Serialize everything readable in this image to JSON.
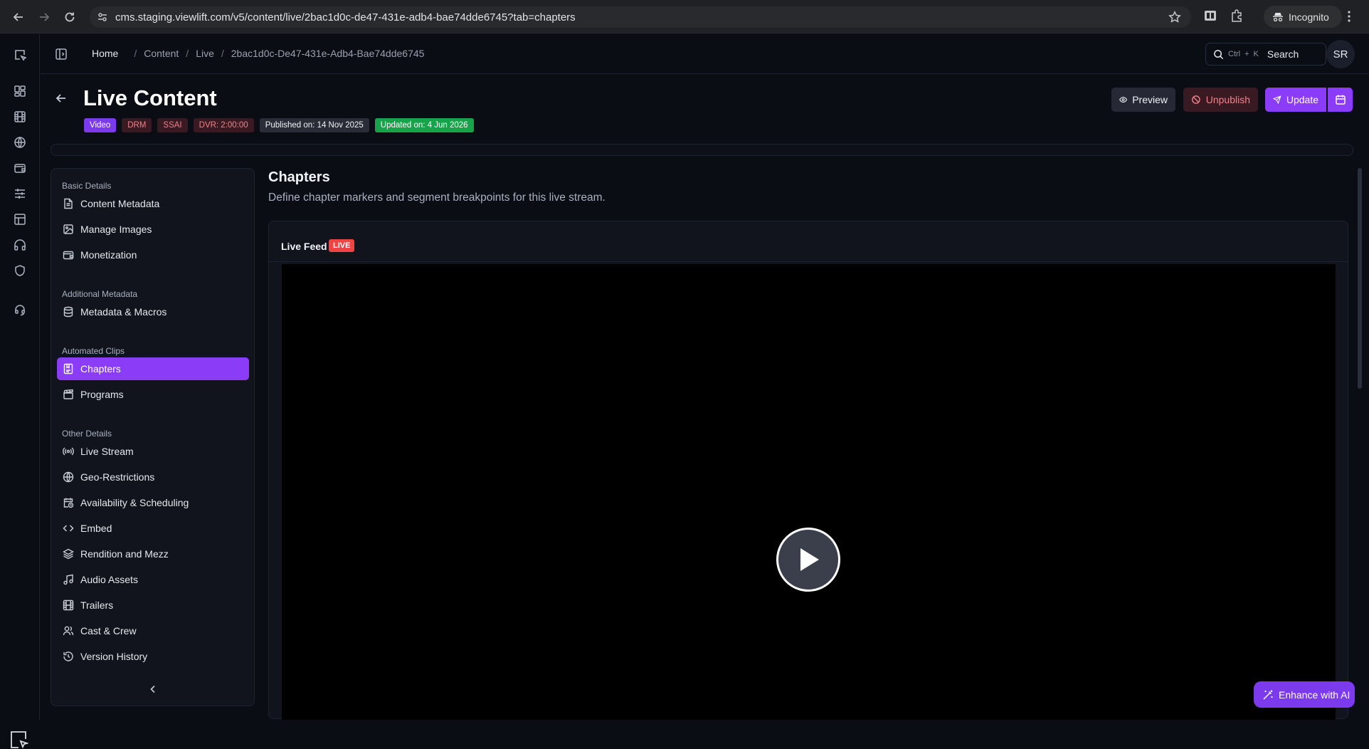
{
  "browser": {
    "url": "cms.staging.viewlift.com/v5/content/live/2bac1d0c-de47-431e-adb4-bae74dde6745?tab=chapters",
    "mode_label": "Incognito"
  },
  "header": {
    "breadcrumbs": {
      "home": "Home",
      "items": [
        "Content",
        "Live",
        "2bac1d0c-De47-431e-Adb4-Bae74dde6745"
      ]
    },
    "search": {
      "shortcut_mod": "Ctrl",
      "shortcut_plus": "+",
      "shortcut_key": "K",
      "label": "Search"
    },
    "avatar_initials": "SR"
  },
  "page": {
    "title": "Live Content",
    "badges": {
      "type": "Video",
      "drm": "DRM",
      "ssai": "SSAI",
      "dvr": "DVR: 2:00:00",
      "published": "Published on: 14 Nov 2025",
      "updated": "Updated on: 4 Jun 2026"
    },
    "actions": {
      "preview": "Preview",
      "unpublish": "Unpublish",
      "update": "Update"
    }
  },
  "sidenav": {
    "sections": [
      {
        "title": "Basic Details",
        "items": [
          "Content Metadata",
          "Manage Images",
          "Monetization"
        ]
      },
      {
        "title": "Additional Metadata",
        "items": [
          "Metadata & Macros"
        ]
      },
      {
        "title": "Automated Clips",
        "items": [
          "Chapters",
          "Programs"
        ]
      },
      {
        "title": "Other Details",
        "items": [
          "Live Stream",
          "Geo-Restrictions",
          "Availability & Scheduling",
          "Embed",
          "Rendition and Mezz",
          "Audio Assets",
          "Trailers",
          "Cast & Crew",
          "Version History"
        ]
      }
    ],
    "active_item": "Chapters"
  },
  "main": {
    "heading": "Chapters",
    "description": "Define chapter markers and segment breakpoints for this live stream.",
    "feed": {
      "label": "Live Feed",
      "status": "LIVE"
    }
  },
  "floating": {
    "enhance_label": "Enhance with AI"
  },
  "colors": {
    "accent": "#8b3cf6",
    "live": "#ef4444",
    "success": "#16a34a",
    "danger_text": "#f2808a",
    "background": "#0b0d14",
    "panel": "#11141d"
  }
}
